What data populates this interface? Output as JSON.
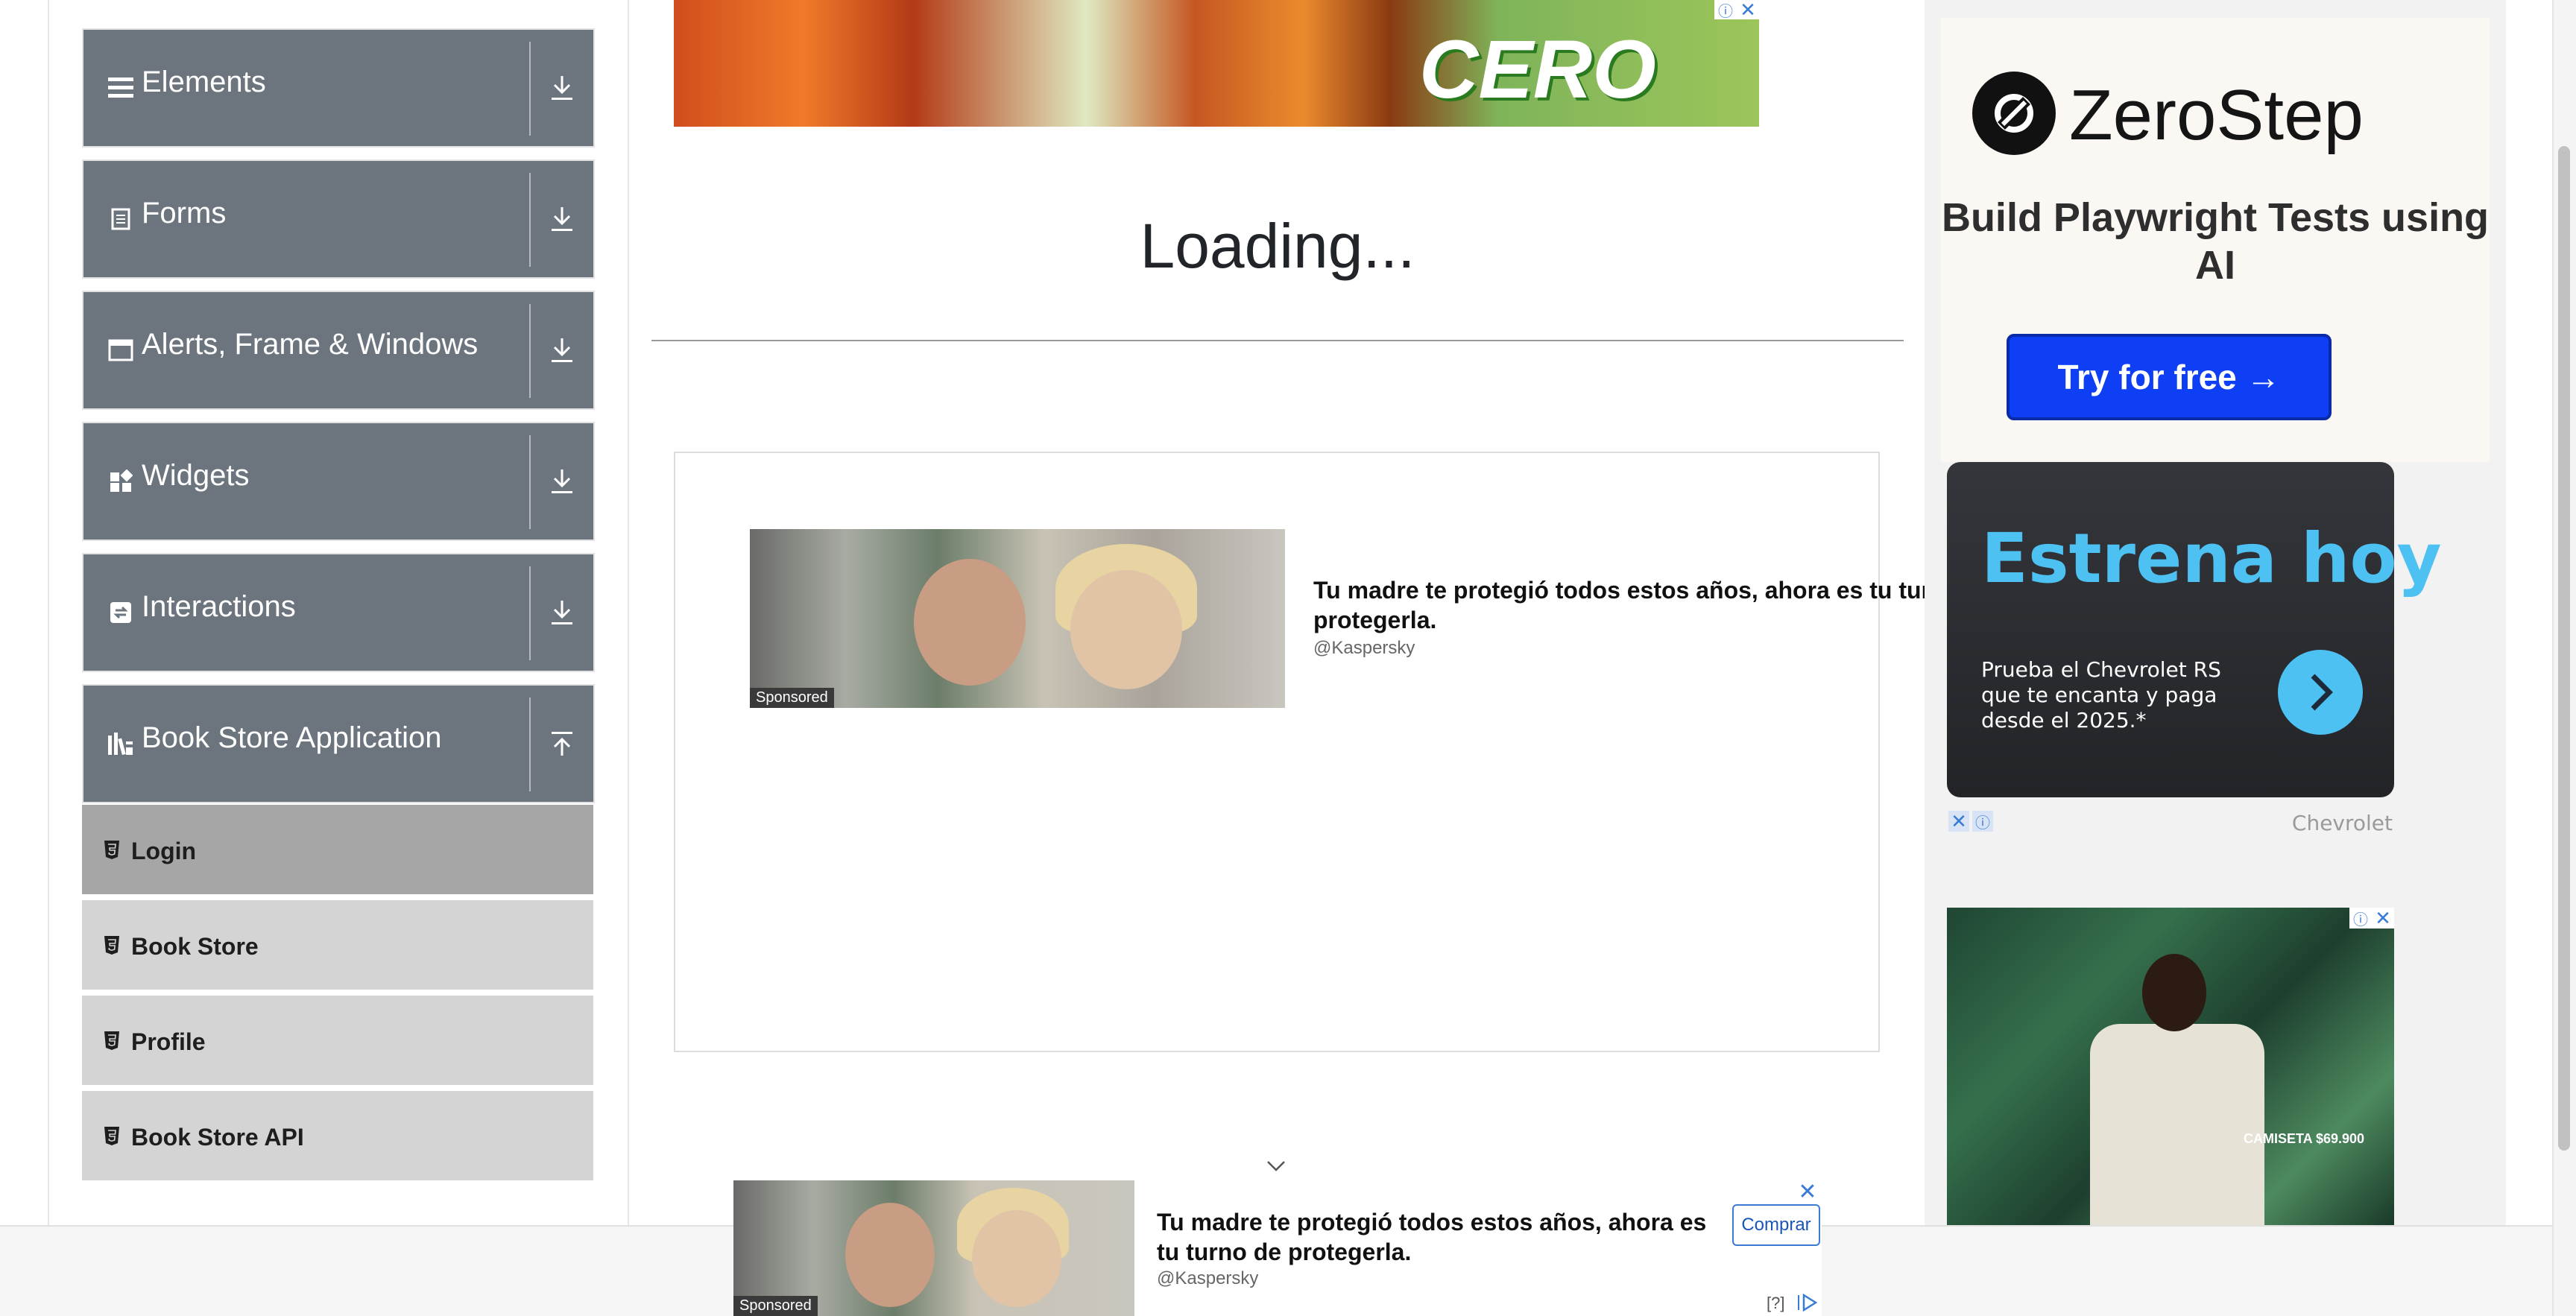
{
  "sidebar": {
    "groups": [
      {
        "label": "Elements",
        "icon": "hamburger-icon",
        "state": "collapsed"
      },
      {
        "label": "Forms",
        "icon": "form-icon",
        "state": "collapsed"
      },
      {
        "label": "Alerts, Frame & Windows",
        "icon": "window-icon",
        "state": "collapsed"
      },
      {
        "label": "Widgets",
        "icon": "widgets-icon",
        "state": "collapsed"
      },
      {
        "label": "Interactions",
        "icon": "interactions-icon",
        "state": "collapsed"
      },
      {
        "label": "Book Store Application",
        "icon": "library-icon",
        "state": "expanded"
      }
    ],
    "book_store_items": [
      {
        "label": "Login",
        "active": true
      },
      {
        "label": "Book Store",
        "active": false
      },
      {
        "label": "Profile",
        "active": false
      },
      {
        "label": "Book Store API",
        "active": false
      }
    ]
  },
  "main": {
    "loading_text": "Loading..."
  },
  "ads": {
    "top_banner": {
      "brand": "CERO"
    },
    "kaspersky_inline": {
      "headline": "Tu madre te protegió todos estos años, ahora es tu tur protegerla.",
      "brand": "@Kaspersky",
      "sponsored": "Sponsored"
    },
    "kaspersky_sticky": {
      "headline": "Tu madre te protegió todos estos años, ahora es tu turno de protegerla.",
      "brand": "@Kaspersky",
      "sponsored": "Sponsored",
      "cta": "Comprar",
      "help": "[?]"
    },
    "zerostep": {
      "name": "ZeroStep",
      "headline": "Build Playwright Tests using AI",
      "cta": "Try for free →"
    },
    "chevrolet": {
      "title": "Estrena hoy",
      "text": "Prueba el Chevrolet RS que te encanta y paga desde el 2025.*",
      "brand": "Chevrolet"
    },
    "fashion": {
      "caption": "CAMISETA $69.900"
    }
  },
  "colors": {
    "sidebar_group_bg": "#6c757d",
    "sidebar_item_bg": "#d4d4d4",
    "sidebar_item_active_bg": "#a6a6a6",
    "zerostep_cta": "#0e3ff4",
    "chevrolet_accent": "#4cc1f2"
  }
}
